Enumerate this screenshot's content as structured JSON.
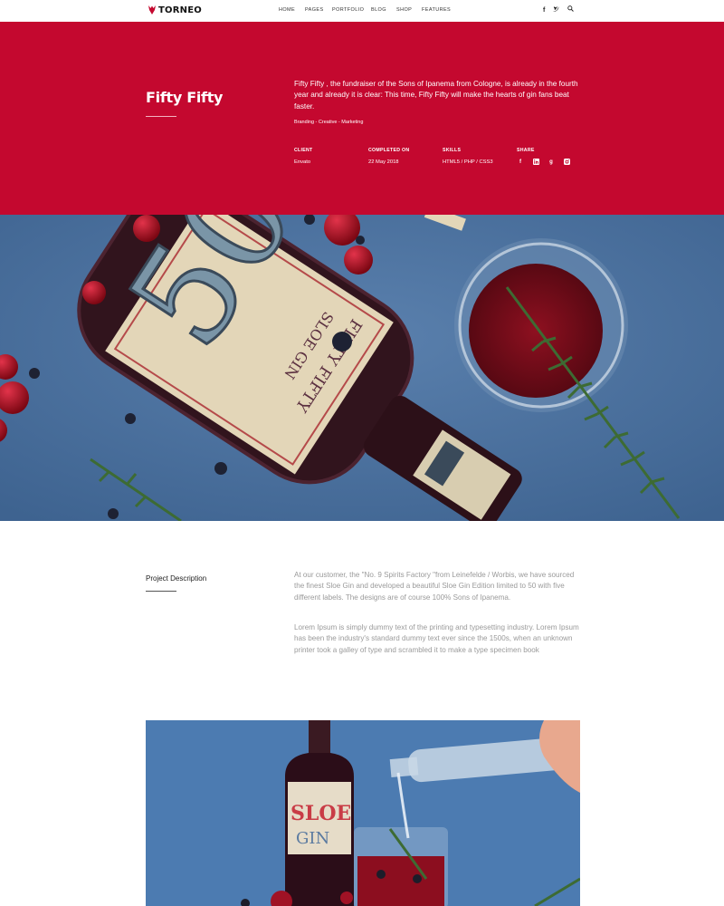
{
  "brand": {
    "logo_text": "TORNEO",
    "accent": "#c4082f"
  },
  "nav": {
    "items": [
      "HOME",
      "PAGES",
      "PORTFOLIO",
      "BLOG",
      "SHOP",
      "FEATURES"
    ],
    "icons": [
      "facebook-icon",
      "twitter-icon",
      "search-icon"
    ]
  },
  "hero": {
    "title": "Fifty Fifty",
    "description": "Fifty Fifty , the fundraiser of the Sons of Ipanema from Cologne, is already in the fourth year and already it is clear: This time, Fifty Fifty will make the hearts of gin fans beat faster.",
    "tags": "Branding - Creative - Marketing",
    "meta": {
      "client_label": "CLIENT",
      "client_value": "Envato",
      "completed_label": "COMPLETED ON",
      "completed_value": "22 May 2018",
      "skills_label": "SKILLS",
      "skills_value": "HTML5 / PHP / CSS3",
      "share_label": "SHARE"
    },
    "share_icons": [
      "facebook-icon",
      "linkedin-icon",
      "google-plus-icon",
      "instagram-icon"
    ]
  },
  "project": {
    "label": "Project Description",
    "paragraph_1": "At our customer, the \"No. 9 Spirits Factory \"from Leinefelde / Worbis, we have sourced the finest Sloe Gin and developed a beautiful Sloe Gin Edition limited to 50 with five different labels. The designs are of course 100% Sons of Ipanema.",
    "paragraph_2": "Lorem Ipsum is simply dummy text of the printing and typesetting industry. Lorem Ipsum has been the industry's standard dummy text ever since the 1500s, when an unknown printer took a galley of type and scrambled it to make a type specimen book"
  }
}
